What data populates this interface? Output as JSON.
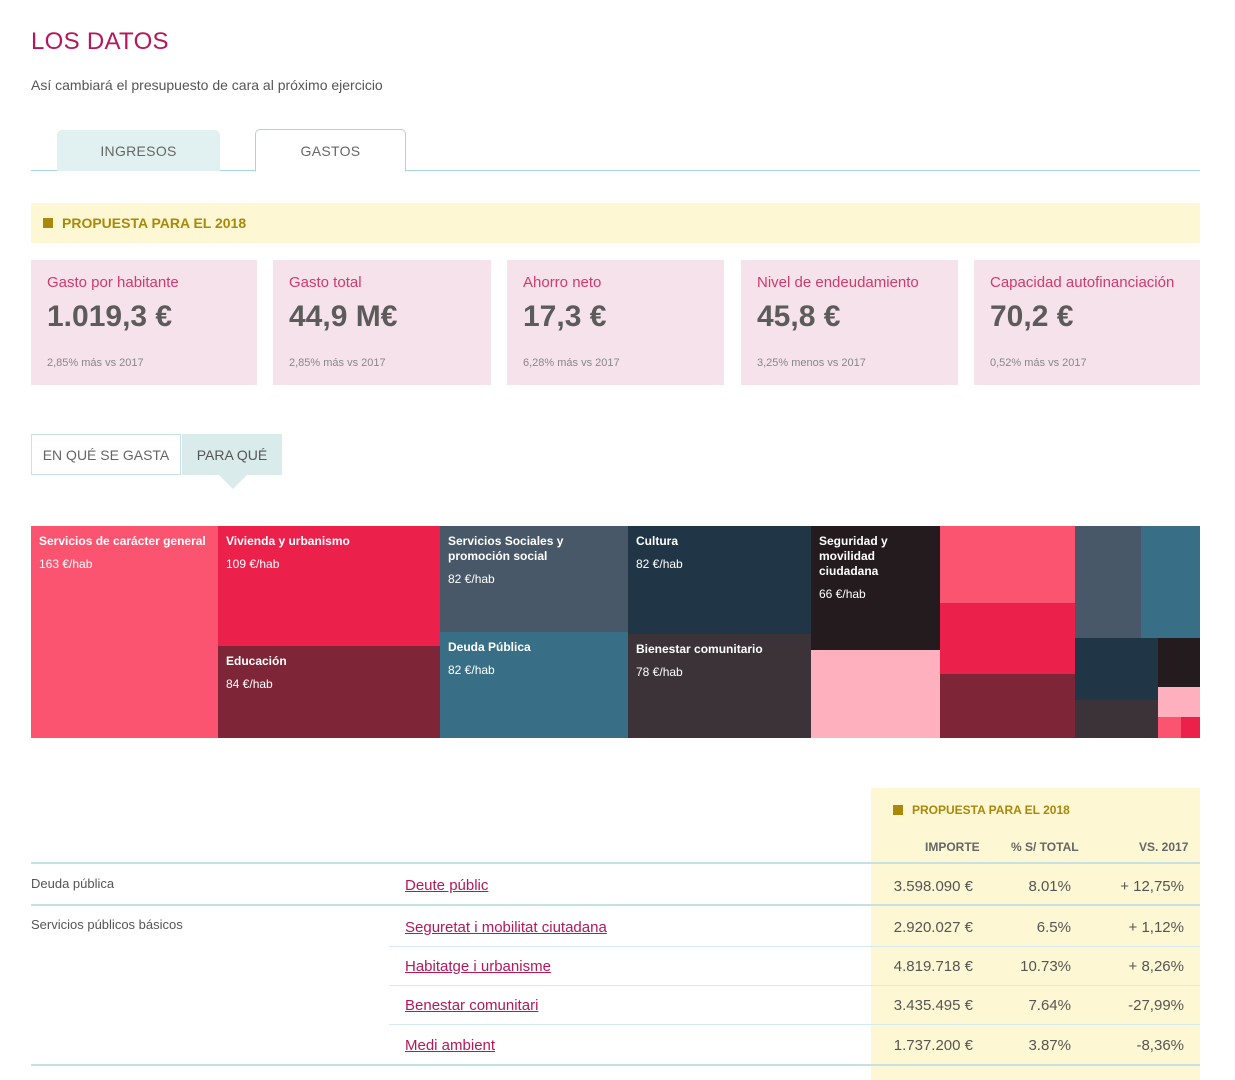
{
  "header": {
    "title": "LOS DATOS",
    "subtitle": "Así cambiará el presupuesto de cara al próximo ejercicio"
  },
  "tabs": [
    {
      "label": "INGRESOS",
      "active": false
    },
    {
      "label": "GASTOS",
      "active": true
    }
  ],
  "proposal": {
    "label": "PROPUESTA PARA EL 2018"
  },
  "cards": [
    {
      "label": "Gasto por habitante",
      "value": "1.019,3 €",
      "change": "2,85% más vs 2017"
    },
    {
      "label": "Gasto total",
      "value": "44,9 M€",
      "change": "2,85% más vs 2017"
    },
    {
      "label": "Ahorro neto",
      "value": "17,3 €",
      "change": "6,28% más vs 2017"
    },
    {
      "label": "Nivel de endeudamiento",
      "value": "45,8 €",
      "change": "3,25% menos vs 2017"
    },
    {
      "label": "Capacidad autofinanciación",
      "value": "70,2 €",
      "change": "0,52% más vs 2017"
    }
  ],
  "view_toggle": [
    {
      "label": "EN QUÉ SE GASTA",
      "active": false
    },
    {
      "label": "PARA QUÉ",
      "active": true
    }
  ],
  "treemap": {
    "colors": {
      "pink": "#fb5470",
      "crimson": "#eb204b",
      "wine": "#7e2637",
      "slate": "#485868",
      "steel": "#386f86",
      "navy": "#203646",
      "charcoal": "#3b3337",
      "black": "#231b1e",
      "lightpink": "#feb0be"
    },
    "cells": [
      {
        "name": "Servicios de carácter general",
        "value": "163 €/hab",
        "color": "#fb5470"
      },
      {
        "name": "Vivienda y urbanismo",
        "value": "109 €/hab",
        "color": "#eb204b"
      },
      {
        "name": "Educación",
        "value": "84 €/hab",
        "color": "#7e2637"
      },
      {
        "name": "Servicios Sociales y promoción social",
        "value": "82 €/hab",
        "color": "#485868"
      },
      {
        "name": "Deuda Pública",
        "value": "82 €/hab",
        "color": "#386f86"
      },
      {
        "name": "Cultura",
        "value": "82 €/hab",
        "color": "#203646"
      },
      {
        "name": "Bienestar comunitario",
        "value": "78 €/hab",
        "color": "#3b3337"
      },
      {
        "name": "Seguridad y movilidad ciudadana",
        "value": "66 €/hab",
        "color": "#231b1e"
      }
    ]
  },
  "table": {
    "band_label": "PROPUESTA PARA EL 2018",
    "columns": [
      "IMPORTE",
      "% S/ TOTAL",
      "VS. 2017"
    ],
    "groups": [
      "Deuda pública",
      "Servicios públicos básicos"
    ],
    "rows": [
      {
        "name": "Deute públic",
        "amount": "3.598.090 €",
        "pct": "8.01%",
        "vs": "+ 12,75%"
      },
      {
        "name": "Seguretat i mobilitat ciutadana",
        "amount": "2.920.027 €",
        "pct": "6.5%",
        "vs": "+ 1,12%"
      },
      {
        "name": "Habitatge i urbanisme",
        "amount": "4.819.718 €",
        "pct": "10.73%",
        "vs": "+ 8,26%"
      },
      {
        "name": "Benestar comunitari",
        "amount": "3.435.495 €",
        "pct": "7.64%",
        "vs": "-27,99%"
      },
      {
        "name": "Medi ambient",
        "amount": "1.737.200 €",
        "pct": "3.87%",
        "vs": "-8,36%"
      }
    ]
  }
}
